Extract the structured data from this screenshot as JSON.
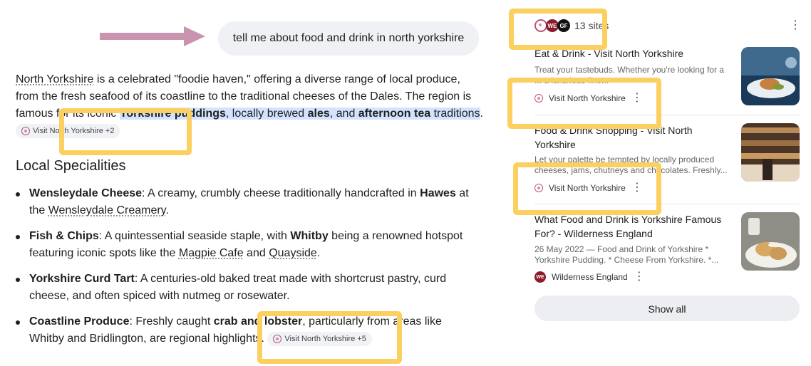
{
  "user_prompt": "tell me about food and drink in north yorkshire",
  "answer": {
    "intro_link": "North Yorkshire",
    "intro_rest": " is a celebrated \"foodie haven,\" offering a diverse range of local produce, from the fresh seafood of its coastline to the traditional cheeses of the Dales. The region is famous for its iconic ",
    "b1": "Yorkshire puddings",
    "t1": ", locally brewed ",
    "b2": "ales",
    "t2": ", and ",
    "b3": "afternoon tea",
    "t3": " traditions",
    "t4": ".",
    "chip1": "Visit North Yorkshire +2"
  },
  "section_heading": "Local Specialities",
  "items": [
    {
      "bold": "Wensleydale Cheese",
      "t1": ": A creamy, crumbly cheese traditionally handcrafted in ",
      "b2": "Hawes",
      "t2": " at the ",
      "link": "Wensleydale Creamery",
      "t3": "."
    },
    {
      "bold": "Fish & Chips",
      "t1": ": A quintessential seaside staple, with ",
      "b2": "Whitby",
      "t2": " being a renowned hotspot featuring iconic spots like the ",
      "link": "Magpie Cafe",
      "t3": " and ",
      "link2": "Quayside",
      "t4": "."
    },
    {
      "bold": "Yorkshire Curd Tart",
      "t1": ": A centuries-old baked treat made with shortcrust pastry, curd cheese, and often spiced with nutmeg or rosewater."
    },
    {
      "bold": "Coastline Produce",
      "t1": ": Freshly caught ",
      "b2": "crab and lobster",
      "t2": ", particularly from areas like Whitby and Bridlington, are regional highlights.",
      "chip": "Visit North Yorkshire +5"
    }
  ],
  "sources": {
    "count_label": "13 sites",
    "cards": [
      {
        "title": "Eat & Drink - Visit North Yorkshire",
        "snippet": "Treat your tastebuds. Whether you're looking for a ... a luxurious fine...",
        "source": "Visit North Yorkshire",
        "thumb_icon": "plated-dish-photo"
      },
      {
        "title": "Food & Drink Shopping - Visit North Yorkshire",
        "snippet": "Let your palette be tempted by locally produced cheeses, jams, chutneys and chocolates. Freshly...",
        "source": "Visit North Yorkshire",
        "thumb_icon": "deli-shop-photo"
      },
      {
        "title": "What Food and Drink is Yorkshire Famous For? - Wilderness England",
        "snippet": "26 May 2022 — Food and Drink of Yorkshire * Yorkshire Pudding. * Cheese From Yorkshire. *...",
        "source": "Wilderness England",
        "thumb_icon": "scones-photo"
      }
    ],
    "show_all": "Show all"
  },
  "favicon_text": {
    "we": "WE",
    "gf": "GF"
  }
}
